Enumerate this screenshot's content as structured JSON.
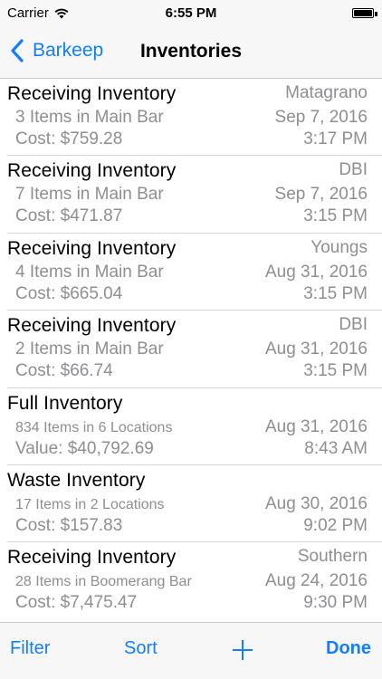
{
  "status_bar": {
    "carrier": "Carrier",
    "time": "6:55 PM"
  },
  "nav": {
    "back_label": "Barkeep",
    "title": "Inventories"
  },
  "inventories": [
    {
      "title": "Receiving Inventory",
      "items": "3 Items in Main Bar",
      "amount": "Cost: $759.28",
      "vendor": "Matagrano",
      "date": "Sep 7, 2016",
      "time": "3:17 PM",
      "small": false
    },
    {
      "title": "Receiving Inventory",
      "items": "7 Items in Main Bar",
      "amount": "Cost: $471.87",
      "vendor": "DBI",
      "date": "Sep 7, 2016",
      "time": "3:15 PM",
      "small": false
    },
    {
      "title": "Receiving Inventory",
      "items": "4 Items in Main Bar",
      "amount": "Cost: $665.04",
      "vendor": "Youngs",
      "date": "Aug 31, 2016",
      "time": "3:15 PM",
      "small": false
    },
    {
      "title": "Receiving Inventory",
      "items": "2 Items in Main Bar",
      "amount": "Cost: $66.74",
      "vendor": "DBI",
      "date": "Aug 31, 2016",
      "time": "3:15 PM",
      "small": false
    },
    {
      "title": "Full Inventory",
      "items": "834 Items in 6 Locations",
      "amount": "Value: $40,792.69",
      "vendor": "",
      "date": "Aug 31, 2016",
      "time": "8:43 AM",
      "small": true
    },
    {
      "title": "Waste Inventory",
      "items": "17 Items in 2 Locations",
      "amount": "Cost: $157.83",
      "vendor": "",
      "date": "Aug 30, 2016",
      "time": "9:02 PM",
      "small": true
    },
    {
      "title": "Receiving Inventory",
      "items": "28 Items in Boomerang Bar",
      "amount": "Cost: $7,475.47",
      "vendor": "Southern",
      "date": "Aug 24, 2016",
      "time": "9:30 PM",
      "small": true
    }
  ],
  "toolbar": {
    "filter_label": "Filter",
    "sort_label": "Sort",
    "done_label": "Done"
  },
  "colors": {
    "tint": "#157efb",
    "secondary_text": "#8e8e93",
    "bar_background": "#f7f7f7"
  },
  "icons": {
    "back": "chevron-left-icon",
    "add": "plus-icon",
    "wifi": "wifi-icon",
    "battery": "battery-icon"
  }
}
